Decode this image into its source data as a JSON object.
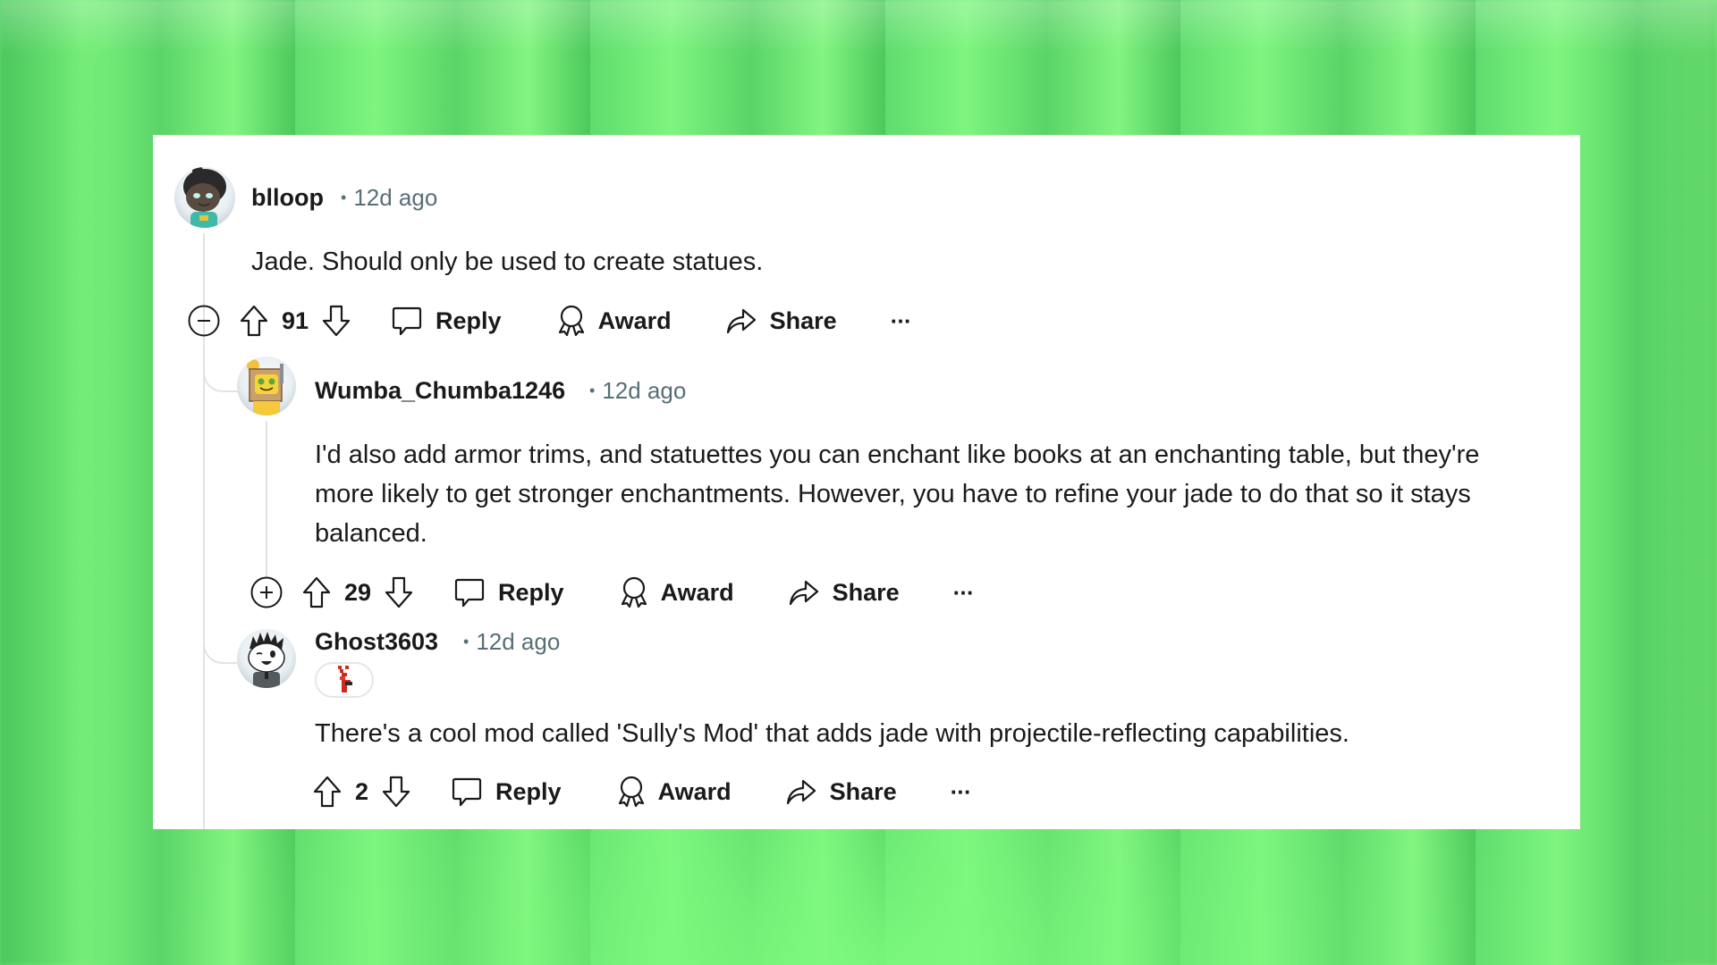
{
  "comments": [
    {
      "username": "blloop",
      "time": "12d ago",
      "body": "Jade. Should only be used to create statues.",
      "score": "91",
      "toggle": "collapse",
      "avatar": "avatar-blloop"
    },
    {
      "username": "Wumba_Chumba1246",
      "time": "12d ago",
      "body": "I'd also add armor trims, and statuettes you can enchant like books at an enchanting table, but they're more likely to get stronger enchantments. However, you have to refine your jade to do that so it stays balanced.",
      "score": "29",
      "toggle": "expand",
      "avatar": "avatar-wumba"
    },
    {
      "username": "Ghost3603",
      "time": "12d ago",
      "flair": "pixel-emoji-flair",
      "body": "There's a cool mod called 'Sully's Mod' that adds jade with projectile-reflecting capabilities.",
      "score": "2",
      "avatar": "avatar-ghost"
    }
  ],
  "actions": {
    "reply": "Reply",
    "award": "Award",
    "share": "Share",
    "more": "···"
  },
  "meta_separator": "•",
  "colors": {
    "text": "#1a1a1b",
    "meta": "#576f76",
    "thread_line": "#e1e3e5",
    "background": "#6ae676",
    "card": "#ffffff"
  }
}
